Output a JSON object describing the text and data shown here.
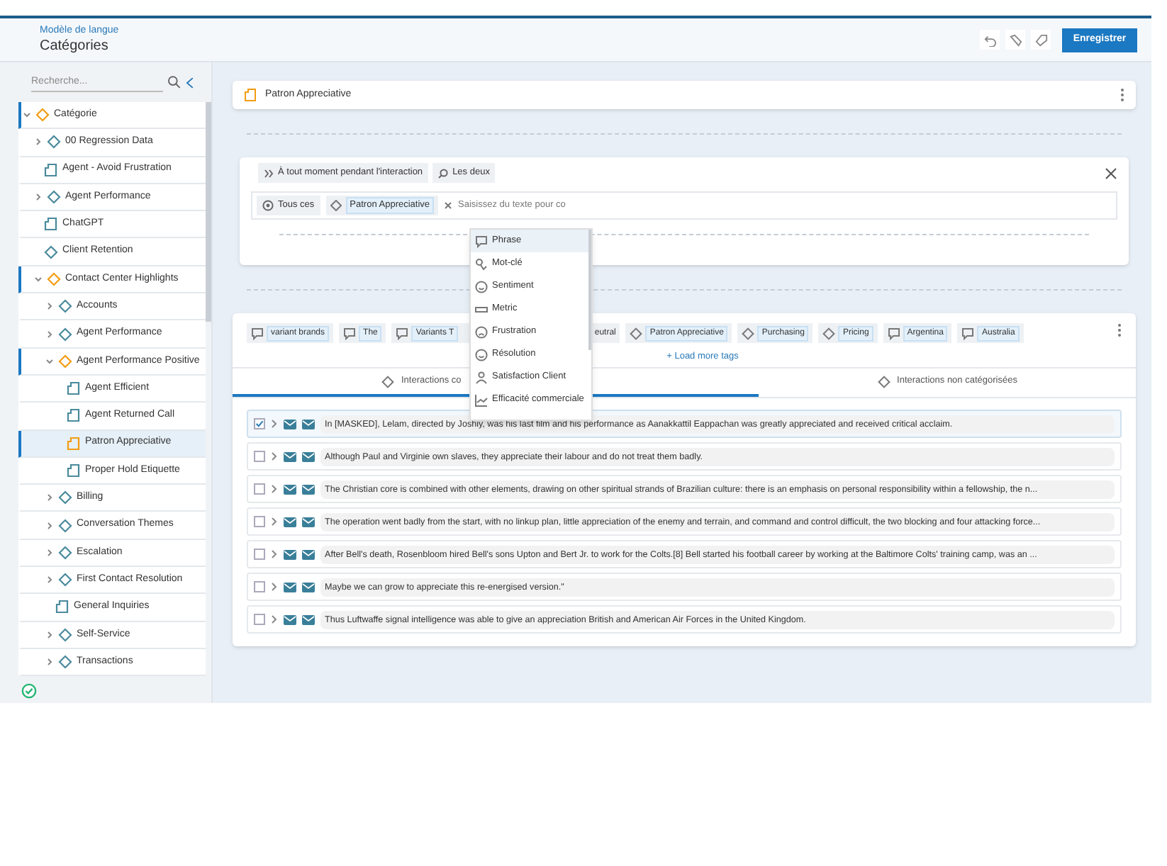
{
  "header": {
    "breadcrumb": "Modèle de langue",
    "title": "Catégories",
    "save_button": "Enregistrer"
  },
  "sidebar": {
    "search_placeholder": "Recherche...",
    "items": [
      {
        "label": "Catégorie",
        "kind": "category",
        "expandable": true,
        "expanded": true,
        "selected": false,
        "children": [
          {
            "label": "00 Regression Data",
            "kind": "category",
            "expandable": true,
            "expanded": false,
            "selected": false
          },
          {
            "label": "Agent - Avoid Frustration",
            "kind": "leaf",
            "selected": false
          },
          {
            "label": "Agent Performance",
            "kind": "category",
            "expandable": true,
            "expanded": false,
            "selected": false
          },
          {
            "label": "ChatGPT",
            "kind": "leaf",
            "selected": false
          },
          {
            "label": "Client Retention",
            "kind": "category",
            "expandable": false,
            "expanded": false,
            "selected": false
          },
          {
            "label": "Contact Center Highlights",
            "kind": "category",
            "expandable": true,
            "expanded": true,
            "selected": false,
            "children": [
              {
                "label": "Accounts",
                "kind": "category",
                "expandable": true,
                "expanded": false,
                "selected": false
              },
              {
                "label": "Agent Performance",
                "kind": "category",
                "expandable": true,
                "expanded": false,
                "selected": false
              },
              {
                "label": "Agent Performance Positive",
                "kind": "category",
                "expandable": true,
                "expanded": true,
                "selected": false,
                "children": [
                  {
                    "label": "Agent Efficient",
                    "kind": "leaf",
                    "selected": false
                  },
                  {
                    "label": "Agent Returned Call",
                    "kind": "leaf",
                    "selected": false
                  },
                  {
                    "label": "Patron Appreciative",
                    "kind": "leaf",
                    "selected": true
                  },
                  {
                    "label": "Proper Hold Etiquette",
                    "kind": "leaf",
                    "selected": false
                  }
                ]
              },
              {
                "label": "Billing",
                "kind": "category",
                "expandable": true,
                "expanded": false,
                "selected": false
              },
              {
                "label": "Conversation Themes",
                "kind": "category",
                "expandable": true,
                "expanded": false,
                "selected": false
              },
              {
                "label": "Escalation",
                "kind": "category",
                "expandable": true,
                "expanded": false,
                "selected": false
              },
              {
                "label": "First Contact Resolution",
                "kind": "category",
                "expandable": true,
                "expanded": false,
                "selected": false
              },
              {
                "label": "General Inquiries",
                "kind": "leaf",
                "selected": false
              },
              {
                "label": "Self-Service",
                "kind": "category",
                "expandable": true,
                "expanded": false,
                "selected": false
              },
              {
                "label": "Transactions",
                "kind": "category",
                "expandable": true,
                "expanded": false,
                "selected": false
              }
            ]
          }
        ]
      }
    ]
  },
  "category_card": {
    "title": "Patron Appreciative"
  },
  "condition": {
    "timing": "À tout moment pendant l'interaction",
    "speaker": "Les deux",
    "scope": "Tous ces",
    "tag": "Patron Appreciative",
    "input_placeholder": "Saisissez du texte pour co"
  },
  "dropdown": [
    {
      "label": "Phrase",
      "kind": "phrase",
      "selected": true
    },
    {
      "label": "Mot-clé",
      "kind": "keyword",
      "selected": false
    },
    {
      "label": "Sentiment",
      "kind": "smile",
      "selected": false
    },
    {
      "label": "Metric",
      "kind": "metric",
      "selected": false
    },
    {
      "label": "Frustration",
      "kind": "frown",
      "selected": false
    },
    {
      "label": "Résolution",
      "kind": "smile",
      "selected": false
    },
    {
      "label": "Satisfaction Client",
      "kind": "person",
      "selected": false
    },
    {
      "label": "Efficacité commerciale",
      "kind": "chart",
      "selected": false
    }
  ],
  "tags": [
    {
      "label": "variant brands",
      "kind": "phrase"
    },
    {
      "label": "The",
      "kind": "phrase"
    },
    {
      "label": "Variants T",
      "kind": "phrase_covered"
    },
    {
      "label": "eutral",
      "kind": "plain"
    },
    {
      "label": "Patron Appreciative",
      "kind": "category"
    },
    {
      "label": "Purchasing",
      "kind": "category"
    },
    {
      "label": "Pricing",
      "kind": "category"
    },
    {
      "label": "Argentina",
      "kind": "phrase"
    },
    {
      "label": "Australia",
      "kind": "phrase"
    }
  ],
  "load_more": "+ Load more tags",
  "tabs": [
    {
      "label": "Interactions co",
      "selected": true
    },
    {
      "label": "Interactions non catégorisées",
      "selected": false
    }
  ],
  "rows": [
    {
      "checked": true,
      "selected": true,
      "text": "In [MASKED], Lelam, directed by Joshiy, was his last film and his performance as Aanakkattil Eappachan was greatly appreciated and received critical acclaim."
    },
    {
      "checked": false,
      "selected": false,
      "text": "Although Paul and Virginie own slaves, they appreciate their labour and do not treat them badly."
    },
    {
      "checked": false,
      "selected": false,
      "text": "The Christian core is combined with other elements, drawing on other spiritual strands of Brazilian culture: there is an emphasis on personal responsibility within a fellowship, the n..."
    },
    {
      "checked": false,
      "selected": false,
      "text": "The operation went badly from the start, with no linkup plan, little appreciation of the enemy and terrain, and command and control difficult, the two blocking and four attacking force..."
    },
    {
      "checked": false,
      "selected": false,
      "text": "After Bell's death, Rosenbloom hired Bell's sons Upton and Bert Jr. to work for the Colts.[8] Bell started his football career by working at the Baltimore Colts' training camp, was an ..."
    },
    {
      "checked": false,
      "selected": false,
      "text": "Maybe we can grow to appreciate this re-energised version.\""
    },
    {
      "checked": false,
      "selected": false,
      "text": "Thus Luftwaffe signal intelligence was able to give an appreciation British and American Air Forces in the United Kingdom."
    }
  ]
}
